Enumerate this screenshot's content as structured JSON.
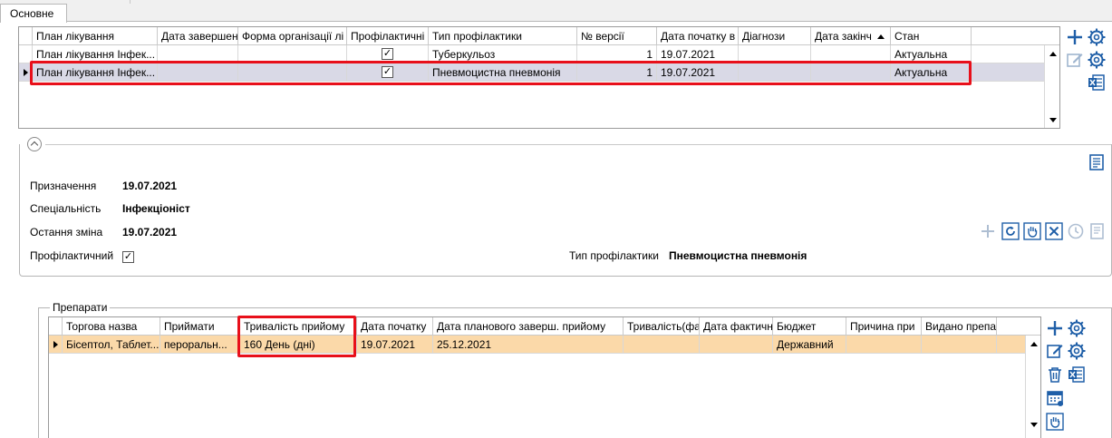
{
  "tabs": [
    {
      "label": "Основне"
    }
  ],
  "plans_grid": {
    "columns": [
      "План лікування",
      "Дата завершен",
      "Форма організації лі",
      "Профілактичні",
      "Тип профілактики",
      "№ версії",
      "Дата початку в",
      "Діагнози",
      "Дата закінч",
      "Стан"
    ],
    "rows": [
      {
        "name": "План лікування Інфек...",
        "end_date": "",
        "form": "",
        "preventive": true,
        "prevention_type": "Туберкульоз",
        "version": "1",
        "start_date": "19.07.2021",
        "diagnoses": "",
        "finish_date": "",
        "status": "Актуальна"
      },
      {
        "name": "План лікування Інфек...",
        "end_date": "",
        "form": "",
        "preventive": true,
        "prevention_type": "Пневмоцистна пневмонія",
        "version": "1",
        "start_date": "19.07.2021",
        "diagnoses": "",
        "finish_date": "",
        "status": "Актуальна"
      }
    ],
    "selected_row": 2,
    "sorted_column": "Дата закінч"
  },
  "details": {
    "appointment_label": "Призначення",
    "appointment_value": "19.07.2021",
    "specialty_label": "Спеціальність",
    "specialty_value": "Інфекціоніст",
    "last_change_label": "Остання зміна",
    "last_change_value": "19.07.2021",
    "preventive_label": "Профілактичний",
    "preventive_checked": true,
    "prevention_type_label": "Тип профілактики",
    "prevention_type_value": "Пневмоцистна пневмонія"
  },
  "drugs": {
    "group_title": "Препарати",
    "columns": [
      "Торгова назва",
      "Приймати",
      "Тривалість прийому",
      "Дата початку",
      "Дата планового заверш. прийому",
      "Тривалість(фа",
      "Дата фактичн",
      "Бюджет",
      "Причина при",
      "Видано препа"
    ],
    "rows": [
      {
        "trade_name": "Бісептол, Таблет...",
        "take": "пероральн...",
        "duration": "160 День (дні)",
        "start": "19.07.2021",
        "planned_end": "25.12.2021",
        "actual_duration": "",
        "actual_date": "",
        "budget": "Державний",
        "reason": "",
        "issued": ""
      }
    ]
  },
  "colors": {
    "highlight": "#e8101a",
    "selected_row": "#d9d9e6",
    "selected_row_orange": "#fbd9a9",
    "icon_blue": "#1f5fa8"
  }
}
